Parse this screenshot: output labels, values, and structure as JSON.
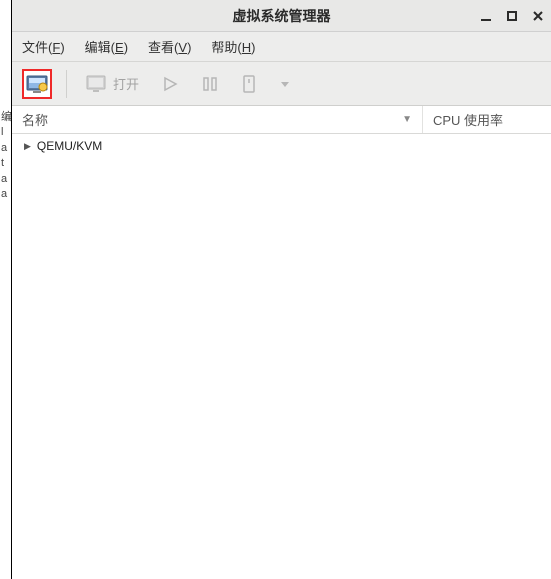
{
  "leftStrip": [
    "编",
    "l",
    "",
    "a",
    "t",
    "a",
    "a"
  ],
  "titlebar": {
    "title": "虚拟系统管理器"
  },
  "menu": {
    "file": {
      "label": "文件",
      "mn": "F"
    },
    "edit": {
      "label": "编辑",
      "mn": "E"
    },
    "view": {
      "label": "查看",
      "mn": "V"
    },
    "help": {
      "label": "帮助",
      "mn": "H"
    }
  },
  "toolbar": {
    "open_label": "打开"
  },
  "columns": {
    "name": "名称",
    "cpu": "CPU 使用率"
  },
  "rows": [
    {
      "label": "QEMU/KVM"
    }
  ]
}
